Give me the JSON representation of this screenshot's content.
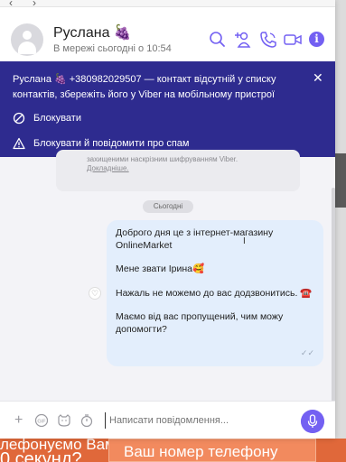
{
  "window": {
    "contact_name": "Руслана 🍇",
    "status": "В мережі сьогодні о 10:54"
  },
  "banner": {
    "message": "Руслана 🍇 +380982029507 — контакт відсутній у списку контактів, збережіть його у Viber на мобільному пристрої",
    "block_label": "Блокувати",
    "block_report_label": "Блокувати й повідомити про спам"
  },
  "chat": {
    "encryption_note": "захищеними наскрізним шифруванням Viber.",
    "encryption_link": "Докладніше.",
    "date_separator": "Сьогодні",
    "message_paragraphs": [
      "Доброго дня це з інтернет-магазину OnlineMarket",
      "Мене звати Ірина🥰",
      "Нажаль не можемо до вас додзвонитись. ☎️",
      "Маємо від вас пропущений, чим можу допомогти?"
    ]
  },
  "composer": {
    "placeholder": "Написати повідомлення..."
  },
  "background_page": {
    "left_text_top": "лефонуємо Вам",
    "left_text_bottom": "0 секунд?",
    "field_placeholder": "Ваш номер телефону"
  },
  "colors": {
    "accent": "#7360f2",
    "banner": "#2e2b8f",
    "bubble": "#e3eefc",
    "page_orange": "#e0683a"
  },
  "icons": [
    "search-icon",
    "add-participant-icon",
    "phone-icon",
    "video-icon",
    "info-icon",
    "close-icon",
    "block-icon",
    "warning-icon",
    "plus-icon",
    "gif-icon",
    "sticker-icon",
    "timer-icon",
    "microphone-icon",
    "heart-icon"
  ]
}
